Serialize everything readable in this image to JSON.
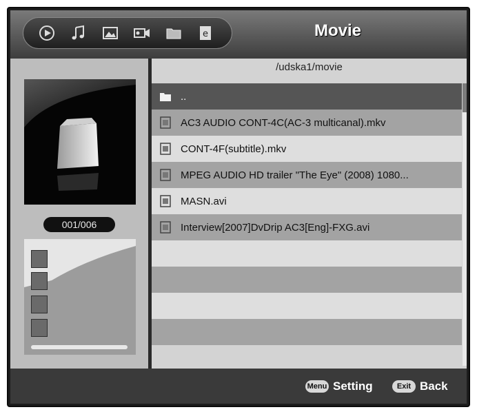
{
  "header": {
    "title": "Movie",
    "toolbar_icons": [
      "play-icon",
      "music-note-icon",
      "photo-icon",
      "video-camera-icon",
      "folder-icon",
      "ebook-icon"
    ]
  },
  "left_panel": {
    "counter": "001/006",
    "side_icons": [
      "landscape-photo-icon",
      "person-icon",
      "monitor-icon",
      "music-photo-icon"
    ]
  },
  "file_browser": {
    "path": "/udska1/movie",
    "rows": [
      {
        "label": "..",
        "icon": "folder-icon",
        "selected": true
      },
      {
        "label": "AC3 AUDIO CONT-4C(AC-3 multicanal).mkv",
        "icon": "film-strip-icon"
      },
      {
        "label": "CONT-4F(subtitle).mkv",
        "icon": "film-strip-icon"
      },
      {
        "label": "MPEG AUDIO HD trailer \"The Eye\" (2008) 1080...",
        "icon": "film-strip-icon"
      },
      {
        "label": "MASN.avi",
        "icon": "film-strip-icon"
      },
      {
        "label": "Interview[2007]DvDrip AC3[Eng]-FXG.avi",
        "icon": "film-strip-icon"
      }
    ]
  },
  "footer": {
    "menu_key": "Menu",
    "menu_label": "Setting",
    "exit_key": "Exit",
    "exit_label": "Back"
  }
}
